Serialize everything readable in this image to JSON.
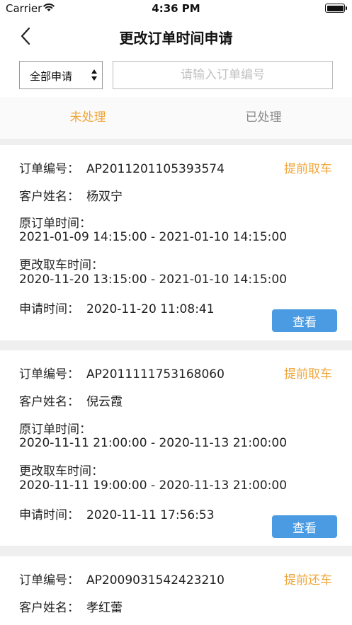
{
  "status_bar": {
    "carrier": "Carrier",
    "time": "4:36 PM",
    "battery_level": 1.0
  },
  "nav": {
    "title": "更改订单时间申请",
    "back_icon": "chevron-left-icon"
  },
  "filter": {
    "select_value": "全部申请",
    "search_placeholder": "请输入订单编号",
    "search_value": ""
  },
  "tabs": [
    {
      "label": "未处理",
      "active": true
    },
    {
      "label": "已处理",
      "active": false
    }
  ],
  "labels": {
    "order_no": "订单编号：",
    "customer": "客户姓名：",
    "original_time": "原订单时间：",
    "changed_time": "更改取车时间：",
    "apply_time": "申请时间：",
    "view_button": "查看"
  },
  "orders": [
    {
      "order_no": "AP2011201105393574",
      "type": "提前取车",
      "customer": "杨双宁",
      "original_time": "2021-01-09 14:15:00 - 2021-01-10 14:15:00",
      "changed_time": "2020-11-20 13:15:00 - 2021-01-10 14:15:00",
      "apply_time": "2020-11-20 11:08:41"
    },
    {
      "order_no": "AP2011111753168060",
      "type": "提前取车",
      "customer": "倪云霞",
      "original_time": "2020-11-11 21:00:00 - 2020-11-13 21:00:00",
      "changed_time": "2020-11-11 19:00:00 - 2020-11-13 21:00:00",
      "apply_time": "2020-11-11 17:56:53"
    },
    {
      "order_no": "AP2009031542423210",
      "type": "提前还车",
      "customer": "孝红蕾"
    }
  ],
  "colors": {
    "accent_orange": "#f0a63a",
    "button_blue": "#4b9be2",
    "background": "#efefef"
  }
}
